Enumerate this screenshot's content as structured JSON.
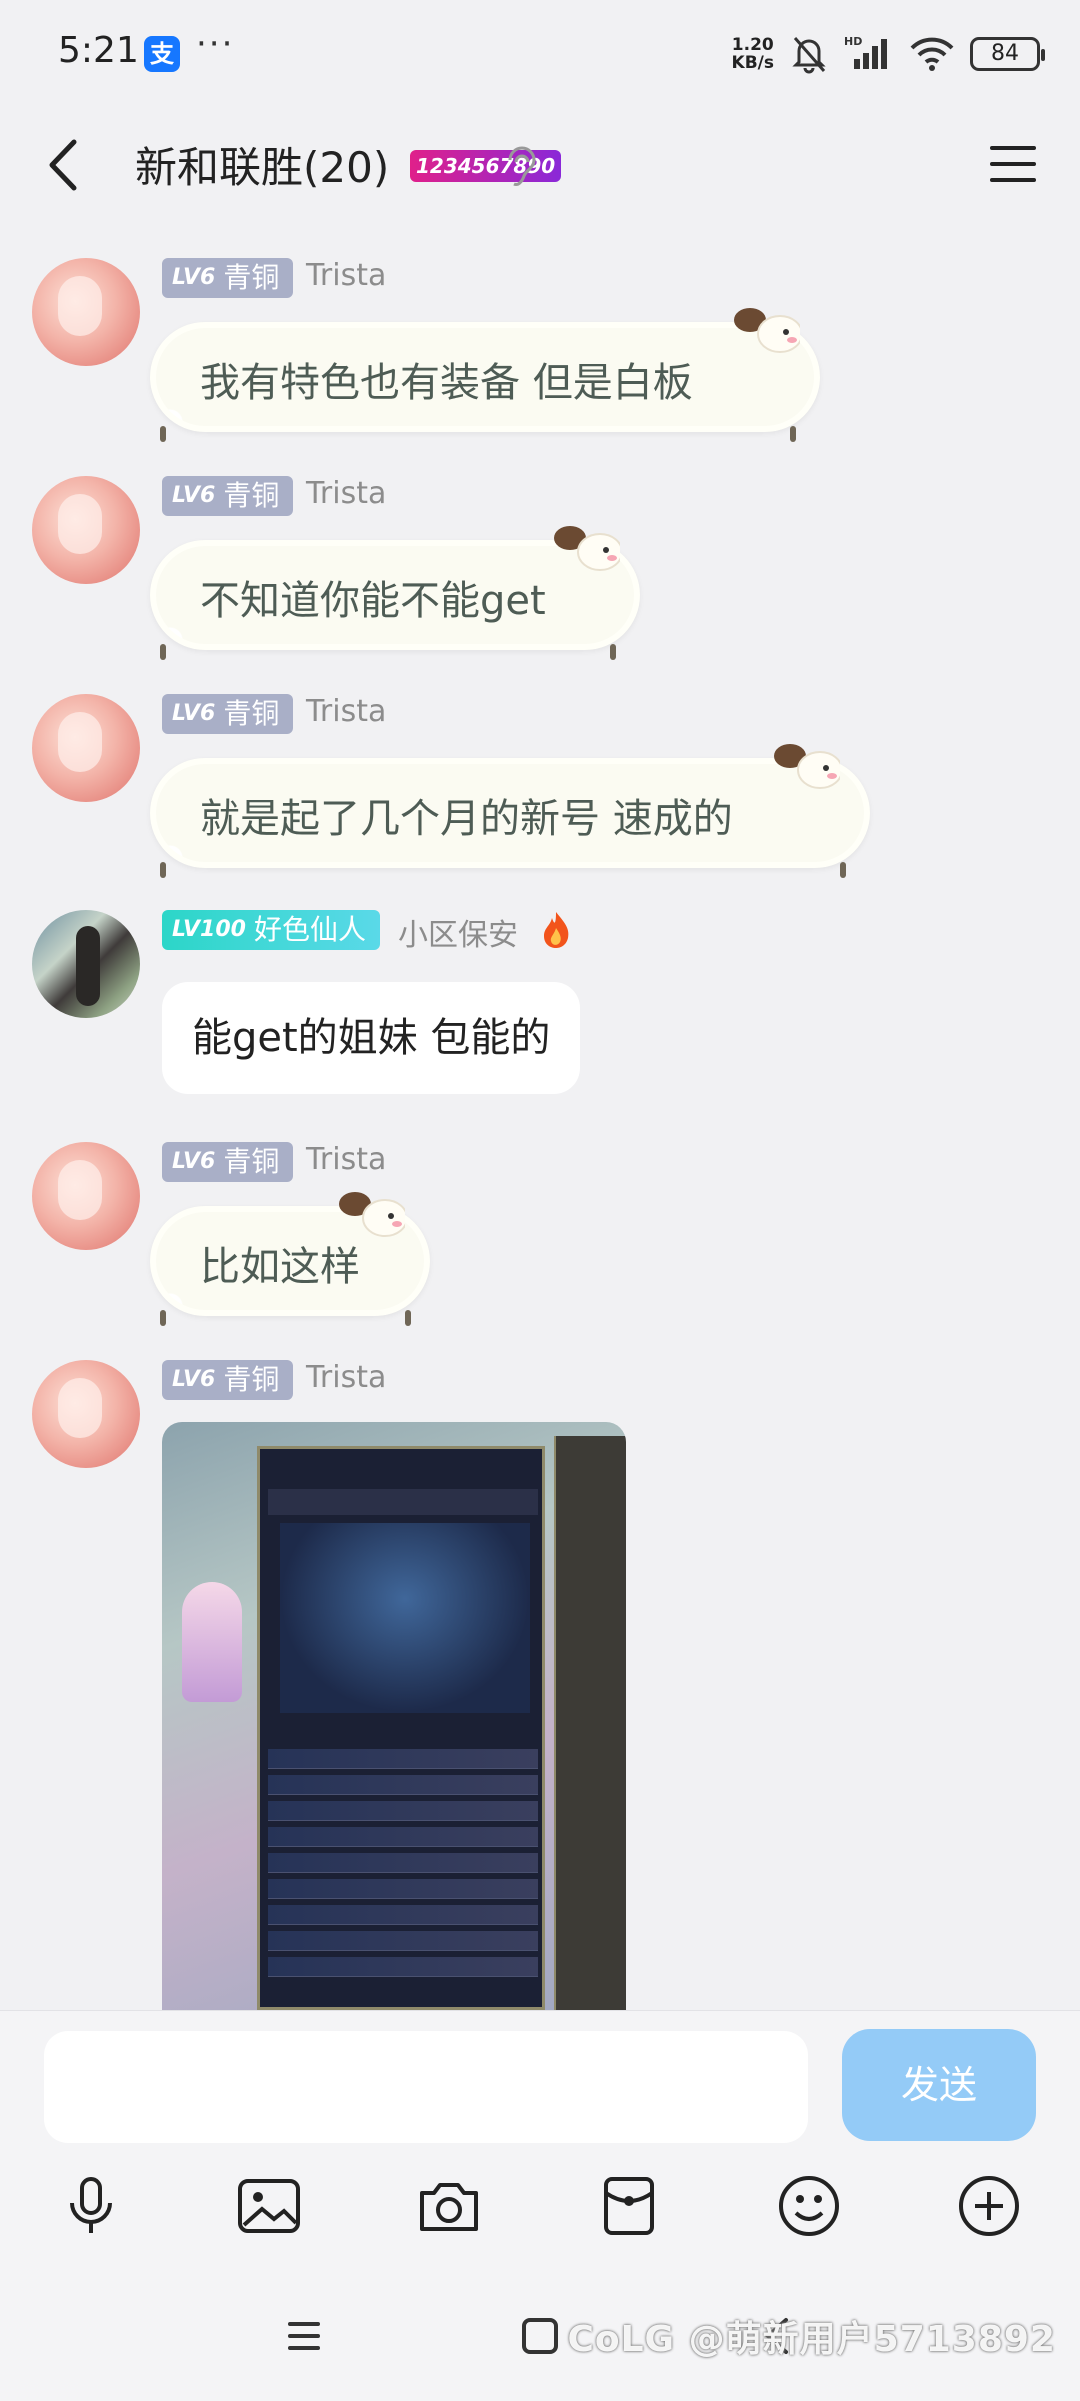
{
  "status_bar": {
    "time": "5:21",
    "app_badge": "支",
    "dots": "···",
    "net_speed_value": "1.20",
    "net_speed_unit": "KB/s",
    "hd_label": "HD",
    "battery": "84"
  },
  "header": {
    "title": "新和联胜(20)",
    "badge": "1234567890"
  },
  "messages": [
    {
      "level": "LV6",
      "rank": "青铜",
      "sender": "Trista",
      "text": "我有特色也有装备  但是白板"
    },
    {
      "level": "LV6",
      "rank": "青铜",
      "sender": "Trista",
      "text": "不知道你能不能get"
    },
    {
      "level": "LV6",
      "rank": "青铜",
      "sender": "Trista",
      "text": "就是起了几个月的新号  速成的"
    },
    {
      "level": "LV100",
      "rank": "好色仙人",
      "sender": "小区保安",
      "text": "能get的姐妹 包能的"
    },
    {
      "level": "LV6",
      "rank": "青铜",
      "sender": "Trista",
      "text": "比如这样"
    },
    {
      "level": "LV6",
      "rank": "青铜",
      "sender": "Trista"
    }
  ],
  "input": {
    "placeholder": "",
    "send_label": "发送"
  },
  "toolbar": {
    "icons": [
      "microphone-icon",
      "image-icon",
      "camera-icon",
      "red-packet-icon",
      "emoji-icon",
      "plus-icon"
    ]
  },
  "watermark": "CoLG @萌新用户5713892",
  "colors": {
    "send_button": "#94cbf7",
    "level_grey": "#a9afc7",
    "level_teal": "#2cd6c8",
    "background": "#f1f1f3"
  }
}
